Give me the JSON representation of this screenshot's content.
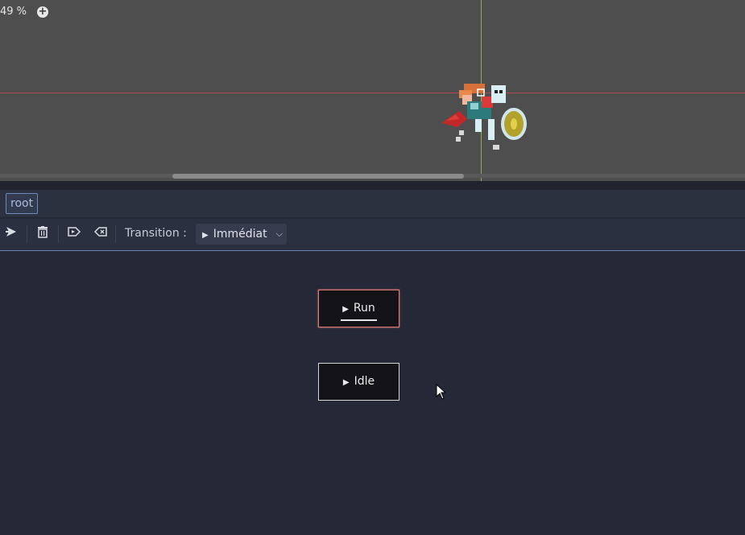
{
  "viewport": {
    "zoom": "49 %",
    "zoom_plus": "+",
    "axis_colors": {
      "vertical": "#8fb14a",
      "horizontal": "#b04a55"
    }
  },
  "path": {
    "root_label": "root"
  },
  "toolbar": {
    "icons": [
      "connect-icon",
      "delete-icon",
      "play-mode-icon",
      "remove-icon"
    ],
    "transition_label": "Transition :",
    "transition_value": "Immédiat"
  },
  "graph": {
    "nodes": [
      {
        "label": "Run",
        "selected": true,
        "accent": "#e07a78"
      },
      {
        "label": "Idle",
        "selected": false
      }
    ]
  }
}
